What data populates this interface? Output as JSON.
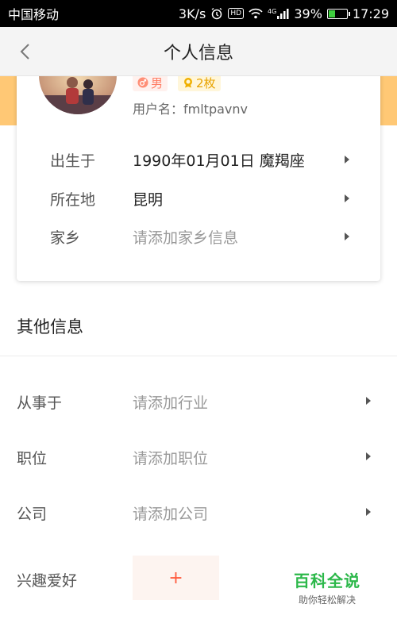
{
  "status_bar": {
    "carrier": "中国移动",
    "speed": "3K/s",
    "network": "4G",
    "battery_percent": "39%",
    "battery_level": 0.39,
    "time": "17:29"
  },
  "nav": {
    "title": "个人信息"
  },
  "profile": {
    "gender": "男",
    "coins": "2枚",
    "username_label": "用户名：",
    "username": "fmltpavnv"
  },
  "basic_info": {
    "birth_label": "出生于",
    "birth_value": "1990年01月01日  魔羯座",
    "location_label": "所在地",
    "location_value": "昆明",
    "hometown_label": "家乡",
    "hometown_placeholder": "请添加家乡信息"
  },
  "other_info": {
    "title": "其他信息",
    "industry_label": "从事于",
    "industry_placeholder": "请添加行业",
    "position_label": "职位",
    "position_placeholder": "请添加职位",
    "company_label": "公司",
    "company_placeholder": "请添加公司",
    "hobby_label": "兴趣爱好",
    "add_label": "+"
  },
  "watermark": {
    "title": "百科全说",
    "subtitle": "助你轻松解决"
  },
  "colors": {
    "accent_orange": "#ffc875",
    "add_red": "#ff5a3d",
    "watermark_green": "#2cb84a"
  }
}
